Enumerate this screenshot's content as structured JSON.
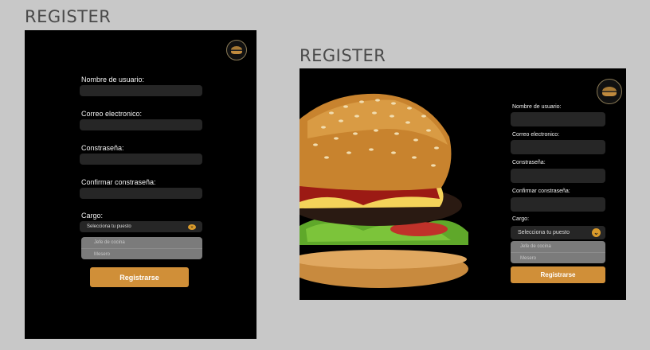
{
  "mobile": {
    "title": "REGISTER",
    "fields": [
      {
        "label": "Nombre de usuario:"
      },
      {
        "label": "Correo electronico:"
      },
      {
        "label": "Constraseña:"
      },
      {
        "label": "Confirmar constraseña:"
      }
    ],
    "cargo": {
      "label": "Cargo:",
      "placeholder": "Selecciona tu puesto",
      "options": [
        "Jefe de cocina",
        "Mesero"
      ]
    },
    "submit_label": "Registrarse"
  },
  "desktop": {
    "title": "REGISTER",
    "fields": [
      {
        "label": "Nombre de usuario:"
      },
      {
        "label": "Correo electronico:"
      },
      {
        "label": "Constraseña:"
      },
      {
        "label": "Confirmar constraseña:"
      }
    ],
    "cargo": {
      "label": "Cargo:",
      "placeholder": "Selecciona tu puesto",
      "options": [
        "Jefe de cocina",
        "Mesero"
      ]
    },
    "submit_label": "Registrarse"
  },
  "colors": {
    "canvas": "#c8c8c8",
    "artboard": "#000000",
    "input": "#262626",
    "accent": "#d08f38",
    "dropdown": "#7b7b7b"
  },
  "icons": [
    "restaurant-logo-icon",
    "chevron-down-icon",
    "burger-image"
  ]
}
